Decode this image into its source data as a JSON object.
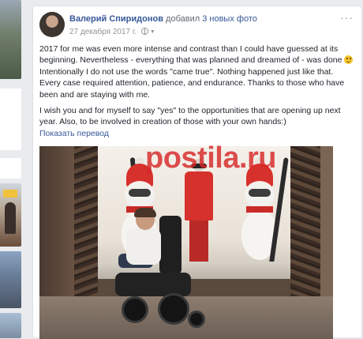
{
  "post": {
    "author": "Валерий Спиридонов",
    "action_prefix": "добавил",
    "action_link": "3 новых фото",
    "date": "27 декабря 2017 г.",
    "options_glyph": "···",
    "paragraphs": [
      {
        "before_emoji": "2017 for me was even more intense and contrast than I could have guessed at its beginning. Nevertheless - everything that was planned and dreamed of - was done ",
        "emoji": "smile-icon",
        "after_emoji": " Intentionally I do not use the words \"came true\". Nothing happened just like that. Every case required attention, patience, and endurance. Thanks to those who have been and are staying with me."
      },
      {
        "text": "I wish you and for myself to say \"yes\" to the opportunities that are opening up next year. Also, to be involved in creation of those with your own hands:)"
      }
    ],
    "translate_link": "Показать перевод"
  },
  "photo": {
    "watermark": "postila.ru"
  },
  "colors": {
    "link": "#365899",
    "watermark": "#d62828",
    "background": "#e9ebee"
  }
}
